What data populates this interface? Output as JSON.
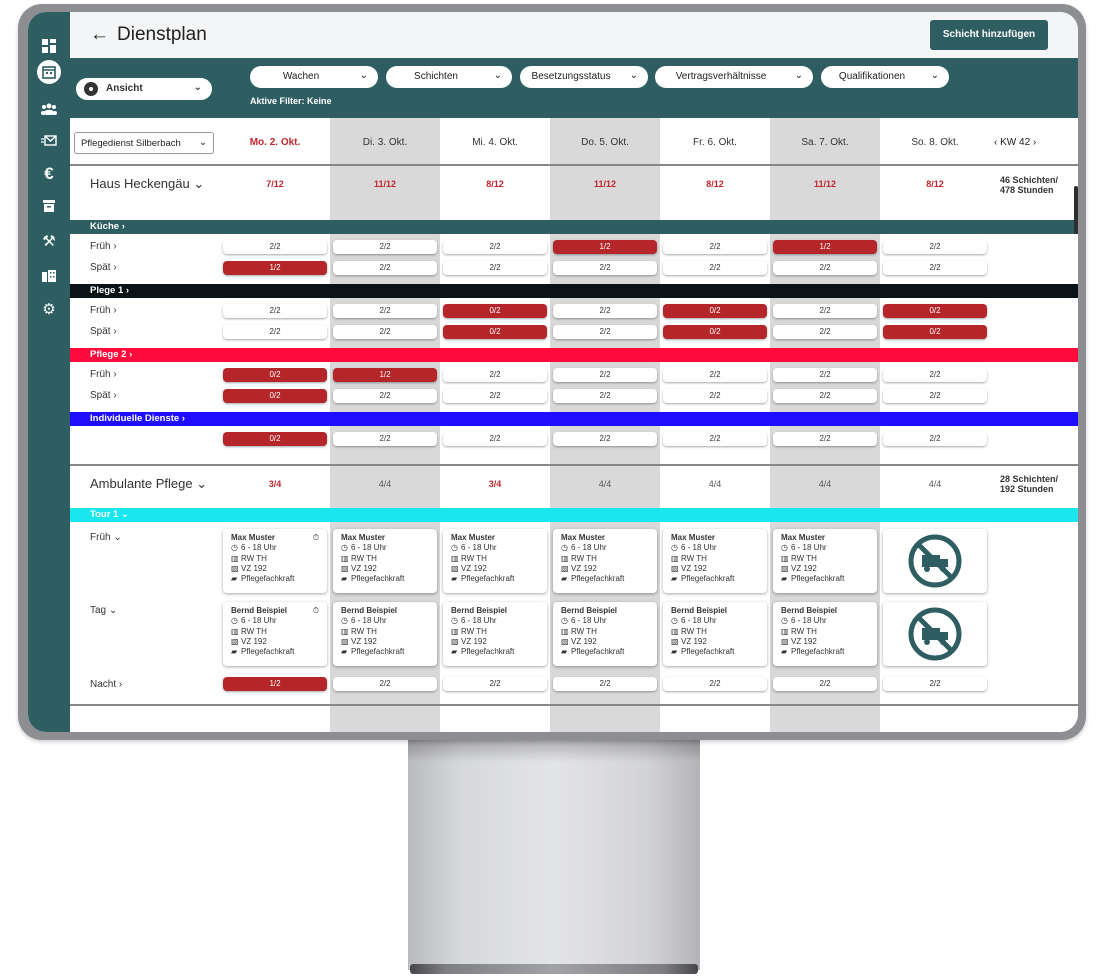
{
  "header": {
    "title": "Dienstplan",
    "back_icon": "arrow-left-icon",
    "add_button": "Schicht hinzufügen"
  },
  "sidebar": {
    "items": [
      "dashboard-icon",
      "calendar-icon",
      "people-icon",
      "mail-icon",
      "euro-icon",
      "archive-icon",
      "tools-icon",
      "building-icon",
      "settings-icon"
    ],
    "active": "calendar-icon"
  },
  "filters": {
    "view_label": "Ansicht",
    "pills": [
      "Wachen",
      "Schichten",
      "Besetzungsstatus",
      "Vertragsverhältnisse",
      "Qualifikationen"
    ],
    "status": "Aktive Filter: Keine"
  },
  "grid": {
    "org": "Pflegedienst Silberbach",
    "days": [
      "Mo. 2. Okt.",
      "Di. 3. Okt.",
      "Mi. 4. Okt.",
      "Do. 5. Okt.",
      "Fr. 6. Okt.",
      "Sa. 7. Okt.",
      "So. 8. Okt."
    ],
    "week": "KW 42"
  },
  "groups": [
    {
      "title": "Haus Heckengäu",
      "counts": [
        "7/12",
        "11/12",
        "8/12",
        "11/12",
        "8/12",
        "11/12",
        "8/12"
      ],
      "total_shifts": "46 Schichten/",
      "total_hours": "478 Stunden",
      "sections": [
        {
          "name": "Küche",
          "color": "#2e5e61",
          "rows": [
            {
              "label": "Früh",
              "cells": [
                "2/2",
                "2/2",
                "2/2",
                "1/2",
                "2/2",
                "1/2",
                "2/2"
              ]
            },
            {
              "label": "Spät",
              "cells": [
                "1/2",
                "2/2",
                "2/2",
                "2/2",
                "2/2",
                "2/2",
                "2/2"
              ]
            }
          ]
        },
        {
          "name": "Plege 1",
          "color": "#0b1316",
          "rows": [
            {
              "label": "Früh",
              "cells": [
                "2/2",
                "2/2",
                "0/2",
                "2/2",
                "0/2",
                "2/2",
                "0/2"
              ]
            },
            {
              "label": "Spät",
              "cells": [
                "2/2",
                "2/2",
                "0/2",
                "2/2",
                "0/2",
                "2/2",
                "0/2"
              ]
            }
          ]
        },
        {
          "name": "Pflege 2",
          "color": "#ff0a3c",
          "rows": [
            {
              "label": "Früh",
              "cells": [
                "0/2",
                "1/2",
                "2/2",
                "2/2",
                "2/2",
                "2/2",
                "2/2"
              ]
            },
            {
              "label": "Spät",
              "cells": [
                "0/2",
                "2/2",
                "2/2",
                "2/2",
                "2/2",
                "2/2",
                "2/2"
              ]
            }
          ]
        },
        {
          "name": "Individuelle Dienste",
          "color": "#1f0dff",
          "rows": [
            {
              "label": "",
              "cells": [
                "0/2",
                "2/2",
                "2/2",
                "2/2",
                "2/2",
                "2/2",
                "2/2"
              ]
            }
          ]
        }
      ]
    },
    {
      "title": "Ambulante Pflege",
      "counts": [
        "3/4",
        "4/4",
        "3/4",
        "4/4",
        "4/4",
        "4/4",
        "4/4"
      ],
      "total_shifts": "28 Schichten/",
      "total_hours": "192 Stunden",
      "tour": "Tour 1",
      "card_rows": [
        {
          "label": "Früh",
          "name": "Max Muster"
        },
        {
          "label": "Tag",
          "name": "Bernd Beispiel"
        }
      ],
      "card_details": {
        "time": "6 - 18 Uhr",
        "vehicle": "RW TH",
        "contract": "VZ 192",
        "qualification": "Pflegefachkraft"
      },
      "night": {
        "label": "Nacht",
        "cells": [
          "1/2",
          "2/2",
          "2/2",
          "2/2",
          "2/2",
          "2/2",
          "2/2"
        ]
      }
    }
  ],
  "status_colors": {
    "shortage": "#b5262a",
    "filled": "#ffffff"
  }
}
